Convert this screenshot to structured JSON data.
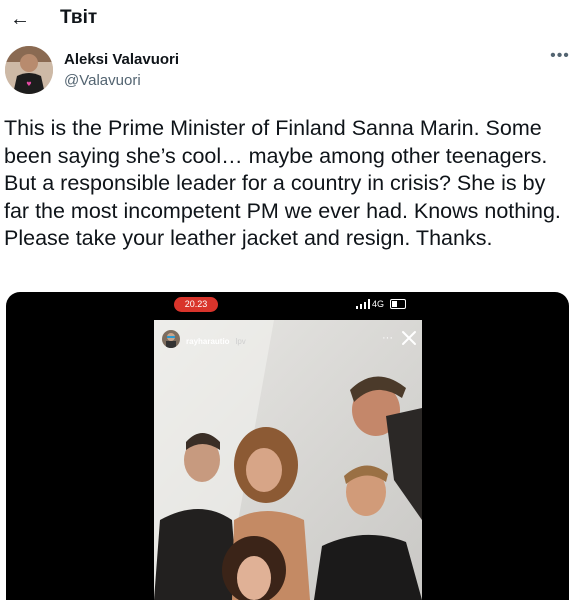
{
  "header": {
    "back_icon": "arrow-left-icon",
    "title": "Твіт"
  },
  "tweet": {
    "author_name": "Aleksi Valavuori",
    "author_handle": "@Valavuori",
    "more_icon": "more-horizontal-icon",
    "text": "This is the Prime Minister of Finland Sanna Marin. Some been saying she’s cool… maybe among other teenagers. But a responsible leader for a country in crisis? She is by far the most incompetent PM we ever had. Knows nothing. Please take your leather jacket and resign. Thanks."
  },
  "media": {
    "status_time": "20.23",
    "network": "4G",
    "story_username": "rayharautio",
    "story_tag": "lpv"
  }
}
